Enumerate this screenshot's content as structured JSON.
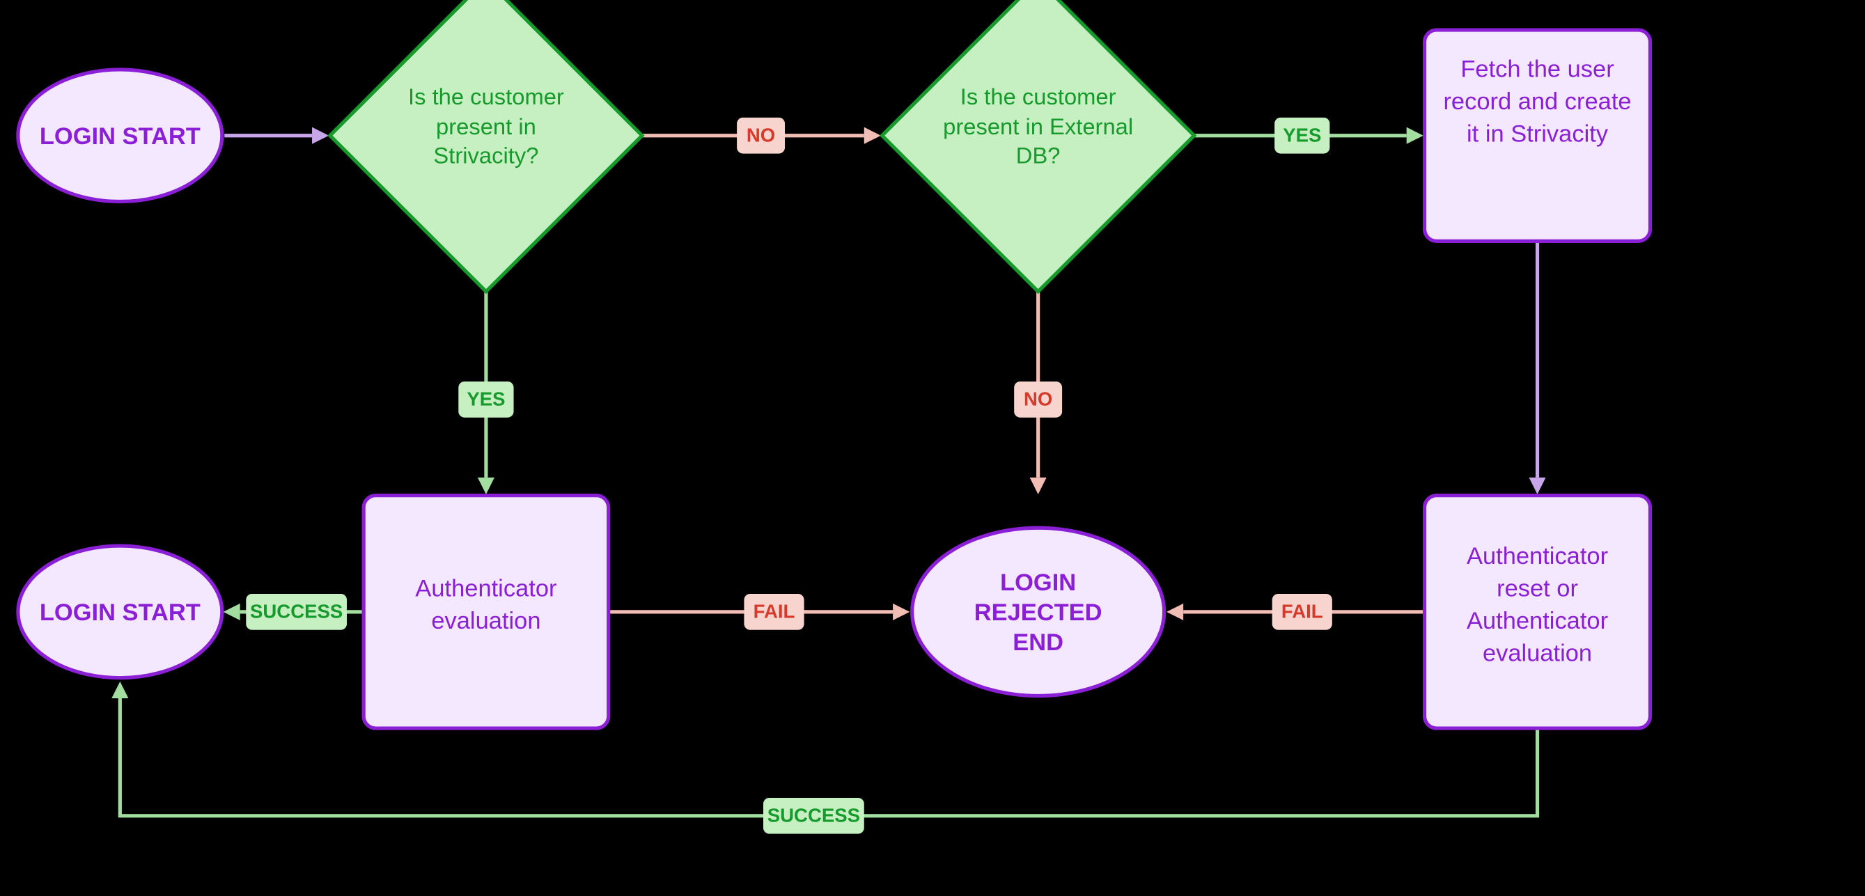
{
  "nodes": {
    "login_start_top": "LOGIN START",
    "decision_strivacity": "Is the customer present in Strivacity?",
    "decision_external": "Is the customer present in External DB?",
    "fetch_record": "Fetch the user record and create it in Strivacity",
    "auth_eval": "Authenticator evaluation",
    "login_rejected_l1": "LOGIN",
    "login_rejected_l2": "REJECTED",
    "login_rejected_l3": "END",
    "auth_reset_l1": "Authenticator",
    "auth_reset_l2": "reset or",
    "auth_reset_l3": "Authenticator",
    "auth_reset_l4": "evaluation",
    "login_start_bottom": "LOGIN START"
  },
  "labels": {
    "no": "NO",
    "yes": "YES",
    "fail": "FAIL",
    "success": "SUCCESS"
  }
}
